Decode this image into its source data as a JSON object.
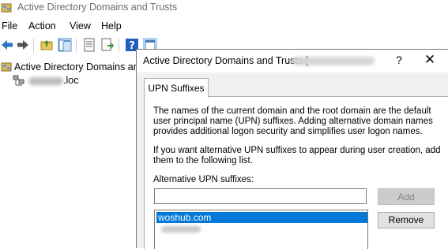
{
  "app": {
    "title": "Active Directory Domains and Trusts"
  },
  "menubar": {
    "items": [
      "File",
      "Action",
      "View",
      "Help"
    ]
  },
  "toolbar": {
    "icons": [
      "back-arrow-icon",
      "forward-arrow-icon",
      "up-folder-icon",
      "show-hide-tree-icon",
      "properties-icon",
      "export-list-icon",
      "help-icon",
      "console-view-icon"
    ]
  },
  "tree": {
    "root_label": "Active Directory Domains and",
    "child_label": ".loc"
  },
  "dialog": {
    "title": "Active Directory Domains and Trusts [ ",
    "help_glyph": "?",
    "close_glyph": "✕",
    "tab_label": "UPN Suffixes",
    "description1": "The names of the current domain and the root domain are the default user principal name (UPN) suffixes. Adding alternative domain names provides additional logon security and simplifies user logon names.",
    "description2": "If you want alternative UPN suffixes to appear during user creation, add them to the following list.",
    "alt_label": "Alternative UPN suffixes:",
    "input_value": "",
    "add_label": "Add",
    "remove_label": "Remove",
    "list": [
      {
        "text": "woshub.com",
        "selected": true
      },
      {
        "text": "",
        "selected": false
      }
    ]
  },
  "colors": {
    "selection": "#0078d7",
    "disabled_button": "#cccccc"
  }
}
